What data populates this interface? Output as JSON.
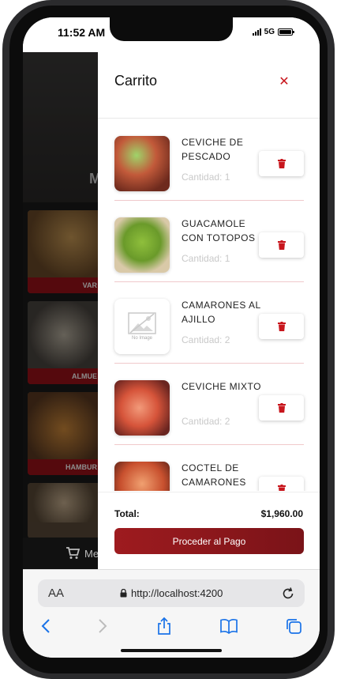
{
  "status": {
    "time": "11:52 AM",
    "network": "5G"
  },
  "background": {
    "hero_title": "M",
    "categories": [
      {
        "label": "VAR"
      },
      {
        "label": "ALMUE"
      },
      {
        "label": "HAMBUR"
      },
      {
        "label": ""
      }
    ],
    "nav_label": "Me"
  },
  "cart": {
    "title": "Carrito",
    "items": [
      {
        "name": "CEVICHE DE PESCADO",
        "quantity": "Cantidad: 1",
        "thumb": "ceviche-photo"
      },
      {
        "name": "GUACAMOLE CON TOTOPOS",
        "quantity": "Cantidad: 1",
        "thumb": "guacamole-photo"
      },
      {
        "name": "CAMARONES AL AJILLO",
        "quantity": "Cantidad: 2",
        "thumb": "no-image-placeholder",
        "no_image_text": "No Image"
      },
      {
        "name": "CEVICHE MIXTO",
        "quantity": "Cantidad: 2",
        "thumb": "ceviche-mixto-photo"
      },
      {
        "name": "COCTEL DE CAMARONES",
        "quantity": "",
        "thumb": "coctel-photo"
      }
    ],
    "total_label": "Total:",
    "total_value": "$1,960.00",
    "checkout_label": "Proceder al Pago"
  },
  "browser": {
    "aa_label": "AA",
    "url": "http://localhost:4200"
  },
  "colors": {
    "accent": "#c8161d",
    "button": "#9e1b1f"
  }
}
